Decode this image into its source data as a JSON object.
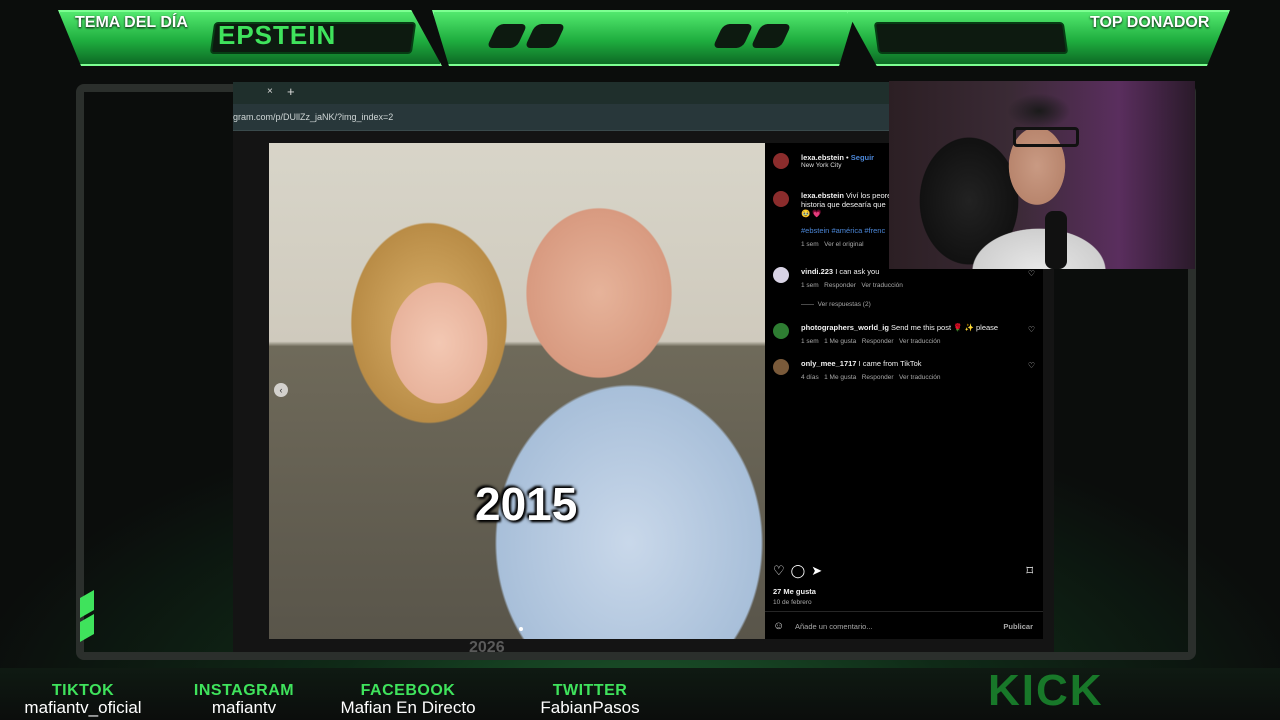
{
  "overlay": {
    "tema_label": "TEMA DEL DÍA",
    "tema_value": "EPSTEIN",
    "top_donador_label": "TOP DONADOR"
  },
  "browser": {
    "tab_close": "×",
    "tab_new": "+",
    "url": "gram.com/p/DUllZz_jaNK/?img_index=2"
  },
  "post": {
    "photo_year": "2026",
    "overlay_year": "2015",
    "prev_icon": "‹",
    "author": "lexa.ebstein",
    "follow": "Seguir",
    "location": "New York City",
    "caption_author": "lexa.ebstein",
    "caption": "Viví los peore",
    "caption_line2": "historia que desearía que",
    "caption_emojis": "🥹 💗",
    "hashtags": "#ebstein #américa #frenc",
    "caption_time": "1 sem",
    "caption_action": "Ver el original",
    "comments": [
      {
        "user": "vindi.223",
        "text": "I can ask you",
        "time": "1 sem",
        "reply": "Responder",
        "translate": "Ver traducción",
        "likes": ""
      },
      {
        "user": "photographers_world_ig",
        "text": "Send me this post 🌹 ✨ please",
        "time": "1 sem",
        "likes": "1 Me gusta",
        "reply": "Responder",
        "translate": "Ver traducción"
      },
      {
        "user": "only_mee_1717",
        "text": "I came from TikTok",
        "time": "4 días",
        "likes": "1 Me gusta",
        "reply": "Responder",
        "translate": "Ver traducción"
      }
    ],
    "view_replies": "Ver respuestas (2)",
    "like_count": "27 Me gusta",
    "date": "10 de febrero",
    "comment_placeholder": "Añade un comentario...",
    "publish": "Publicar"
  },
  "socials": [
    {
      "label": "TIKTOK",
      "handle": "mafiantv_oficial"
    },
    {
      "label": "INSTAGRAM",
      "handle": "mafiantv"
    },
    {
      "label": "FACEBOOK",
      "handle": "Mafian En Directo"
    },
    {
      "label": "TWITTER",
      "handle": "FabianPasos"
    }
  ],
  "kick_logo": "KICK",
  "colors": {
    "accent": "#3fe35c",
    "panel": "#1fae3f",
    "frame": "#2b2f2c",
    "ig_bg": "#000000",
    "link": "#4b86d6"
  }
}
